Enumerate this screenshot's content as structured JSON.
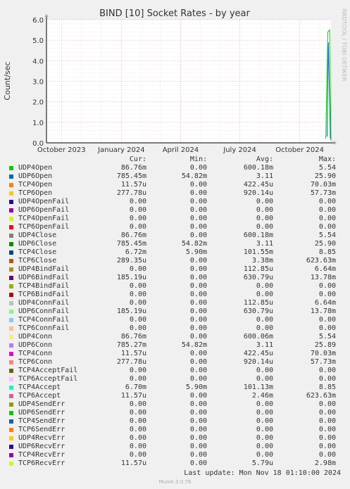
{
  "chart_data": {
    "type": "line",
    "title": "BIND [10] Socket Rates - by year",
    "ylabel": "Count/sec",
    "side_label": "RRDTOOL / TOBI OETIKER",
    "ylim": [
      0,
      6
    ],
    "y_ticks": [
      "0.0",
      "1.0",
      "2.0",
      "3.0",
      "4.0",
      "5.0",
      "6.0"
    ],
    "x_ticks": [
      {
        "label": "October 2023",
        "date": "2023-10-01"
      },
      {
        "label": "January 2024",
        "date": "2024-01-01"
      },
      {
        "label": "April 2024",
        "date": "2024-04-01"
      },
      {
        "label": "July 2024",
        "date": "2024-07-01"
      },
      {
        "label": "October 2024",
        "date": "2024-10-01"
      }
    ],
    "x_range": [
      "2023-09-08",
      "2024-11-18"
    ],
    "grid": true,
    "visible_series": [
      {
        "name": "UDP4Open",
        "color": "#00cc00",
        "points": [
          [
            "2024-11-10",
            0.2
          ],
          [
            "2024-11-13",
            5.4
          ],
          [
            "2024-11-16",
            5.5
          ],
          [
            "2024-11-18",
            0.1
          ]
        ]
      },
      {
        "name": "UDP6Open",
        "color": "#0066b3",
        "points": [
          [
            "2024-11-12",
            0.3
          ],
          [
            "2024-11-14",
            4.9
          ],
          [
            "2024-11-17",
            0.2
          ]
        ]
      }
    ]
  },
  "legend": {
    "headers": {
      "cur": "Cur:",
      "min": "Min:",
      "avg": "Avg:",
      "max": "Max:"
    },
    "rows": [
      {
        "name": "UDP4Open",
        "color": "#00cc00",
        "cur": "86.76m",
        "min": "0.00",
        "avg": "600.18m",
        "max": "5.54"
      },
      {
        "name": "UDP6Open",
        "color": "#0066b3",
        "cur": "785.45m",
        "min": "54.82m",
        "avg": "3.11",
        "max": "25.90"
      },
      {
        "name": "TCP4Open",
        "color": "#ff8000",
        "cur": "11.57u",
        "min": "0.00",
        "avg": "422.45u",
        "max": "70.03m"
      },
      {
        "name": "TCP6Open",
        "color": "#ffcc00",
        "cur": "277.78u",
        "min": "0.00",
        "avg": "920.14u",
        "max": "57.73m"
      },
      {
        "name": "UDP4OpenFail",
        "color": "#330099",
        "cur": "0.00",
        "min": "0.00",
        "avg": "0.00",
        "max": "0.00"
      },
      {
        "name": "UDP6OpenFail",
        "color": "#990099",
        "cur": "0.00",
        "min": "0.00",
        "avg": "0.00",
        "max": "0.00"
      },
      {
        "name": "TCP4OpenFail",
        "color": "#ccff00",
        "cur": "0.00",
        "min": "0.00",
        "avg": "0.00",
        "max": "0.00"
      },
      {
        "name": "TCP6OpenFail",
        "color": "#ff0000",
        "cur": "0.00",
        "min": "0.00",
        "avg": "0.00",
        "max": "0.00"
      },
      {
        "name": "UDP4Close",
        "color": "#808080",
        "cur": "86.76m",
        "min": "0.00",
        "avg": "600.18m",
        "max": "5.54"
      },
      {
        "name": "UDP6Close",
        "color": "#008f00",
        "cur": "785.45m",
        "min": "54.82m",
        "avg": "3.11",
        "max": "25.90"
      },
      {
        "name": "TCP4Close",
        "color": "#00487d",
        "cur": "6.72m",
        "min": "5.90m",
        "avg": "101.55m",
        "max": "8.85"
      },
      {
        "name": "TCP6Close",
        "color": "#b35a00",
        "cur": "289.35u",
        "min": "0.00",
        "avg": "3.38m",
        "max": "623.63m"
      },
      {
        "name": "UDP4BindFail",
        "color": "#b38f00",
        "cur": "0.00",
        "min": "0.00",
        "avg": "112.85u",
        "max": "6.64m"
      },
      {
        "name": "UDP6BindFail",
        "color": "#6b006b",
        "cur": "185.19u",
        "min": "0.00",
        "avg": "630.79u",
        "max": "13.78m"
      },
      {
        "name": "TCP4BindFail",
        "color": "#8fb300",
        "cur": "0.00",
        "min": "0.00",
        "avg": "0.00",
        "max": "0.00"
      },
      {
        "name": "TCP6BindFail",
        "color": "#b30000",
        "cur": "0.00",
        "min": "0.00",
        "avg": "0.00",
        "max": "0.00"
      },
      {
        "name": "UDP4ConnFail",
        "color": "#bebebe",
        "cur": "0.00",
        "min": "0.00",
        "avg": "112.85u",
        "max": "6.64m"
      },
      {
        "name": "UDP6ConnFail",
        "color": "#80ff80",
        "cur": "185.19u",
        "min": "0.00",
        "avg": "630.79u",
        "max": "13.78m"
      },
      {
        "name": "TCP4ConnFail",
        "color": "#80c9ff",
        "cur": "0.00",
        "min": "0.00",
        "avg": "0.00",
        "max": "0.00"
      },
      {
        "name": "TCP6ConnFail",
        "color": "#ffc080",
        "cur": "0.00",
        "min": "0.00",
        "avg": "0.00",
        "max": "0.00"
      },
      {
        "name": "UDP4Conn",
        "color": "#ffe680",
        "cur": "86.76m",
        "min": "0.00",
        "avg": "600.06m",
        "max": "5.54"
      },
      {
        "name": "UDP6Conn",
        "color": "#aa80ff",
        "cur": "785.27m",
        "min": "54.82m",
        "avg": "3.11",
        "max": "25.89"
      },
      {
        "name": "TCP4Conn",
        "color": "#ee00cc",
        "cur": "11.57u",
        "min": "0.00",
        "avg": "422.45u",
        "max": "70.03m"
      },
      {
        "name": "TCP6Conn",
        "color": "#ff8080",
        "cur": "277.78u",
        "min": "0.00",
        "avg": "920.14u",
        "max": "57.73m"
      },
      {
        "name": "TCP4AcceptFail",
        "color": "#666600",
        "cur": "0.00",
        "min": "0.00",
        "avg": "0.00",
        "max": "0.00"
      },
      {
        "name": "TCP6AcceptFail",
        "color": "#ffbfff",
        "cur": "0.00",
        "min": "0.00",
        "avg": "0.00",
        "max": "0.00"
      },
      {
        "name": "TCP4Accept",
        "color": "#00ffcc",
        "cur": "6.70m",
        "min": "5.90m",
        "avg": "101.13m",
        "max": "8.85"
      },
      {
        "name": "TCP6Accept",
        "color": "#cc6699",
        "cur": "11.57u",
        "min": "0.00",
        "avg": "2.46m",
        "max": "623.63m"
      },
      {
        "name": "UDP4SendErr",
        "color": "#999900",
        "cur": "0.00",
        "min": "0.00",
        "avg": "0.00",
        "max": "0.00"
      },
      {
        "name": "UDP6SendErr",
        "color": "#00cc00",
        "cur": "0.00",
        "min": "0.00",
        "avg": "0.00",
        "max": "0.00"
      },
      {
        "name": "TCP4SendErr",
        "color": "#0066b3",
        "cur": "0.00",
        "min": "0.00",
        "avg": "0.00",
        "max": "0.00"
      },
      {
        "name": "TCP6SendErr",
        "color": "#ff8000",
        "cur": "0.00",
        "min": "0.00",
        "avg": "0.00",
        "max": "0.00"
      },
      {
        "name": "UDP4RecvErr",
        "color": "#ffcc00",
        "cur": "0.00",
        "min": "0.00",
        "avg": "0.00",
        "max": "0.00"
      },
      {
        "name": "UDP6RecvErr",
        "color": "#330099",
        "cur": "0.00",
        "min": "0.00",
        "avg": "0.00",
        "max": "0.00"
      },
      {
        "name": "TCP4RecvErr",
        "color": "#990099",
        "cur": "0.00",
        "min": "0.00",
        "avg": "0.00",
        "max": "0.00"
      },
      {
        "name": "TCP6RecvErr",
        "color": "#ccff00",
        "cur": "11.57u",
        "min": "0.00",
        "avg": "5.79u",
        "max": "2.98m"
      }
    ]
  },
  "footer": {
    "last_update": "Last update: Mon Nov 18 01:10:00 2024",
    "munin": "Munin 2.0.76"
  }
}
